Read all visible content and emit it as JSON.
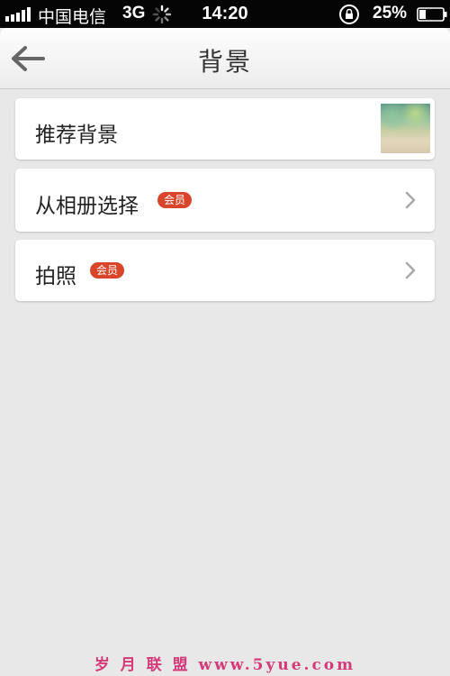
{
  "status_bar": {
    "carrier": "中国电信",
    "network": "3G",
    "time": "14:20",
    "battery": "25%"
  },
  "nav": {
    "title": "背景",
    "back_icon": "arrow-left-icon"
  },
  "items": [
    {
      "label": "推荐背景",
      "badge": "",
      "trailing": "thumbnail"
    },
    {
      "label": "从相册选择",
      "badge": "会员",
      "trailing": "chevron-right-icon"
    },
    {
      "label": "拍照",
      "badge": "会员",
      "trailing": "chevron-right-icon"
    }
  ],
  "watermark": "岁 月 联 盟  www.5yue.com",
  "colors": {
    "background": "#e8e8e8",
    "badge": "#d9452b",
    "watermark": "#d43a78"
  }
}
